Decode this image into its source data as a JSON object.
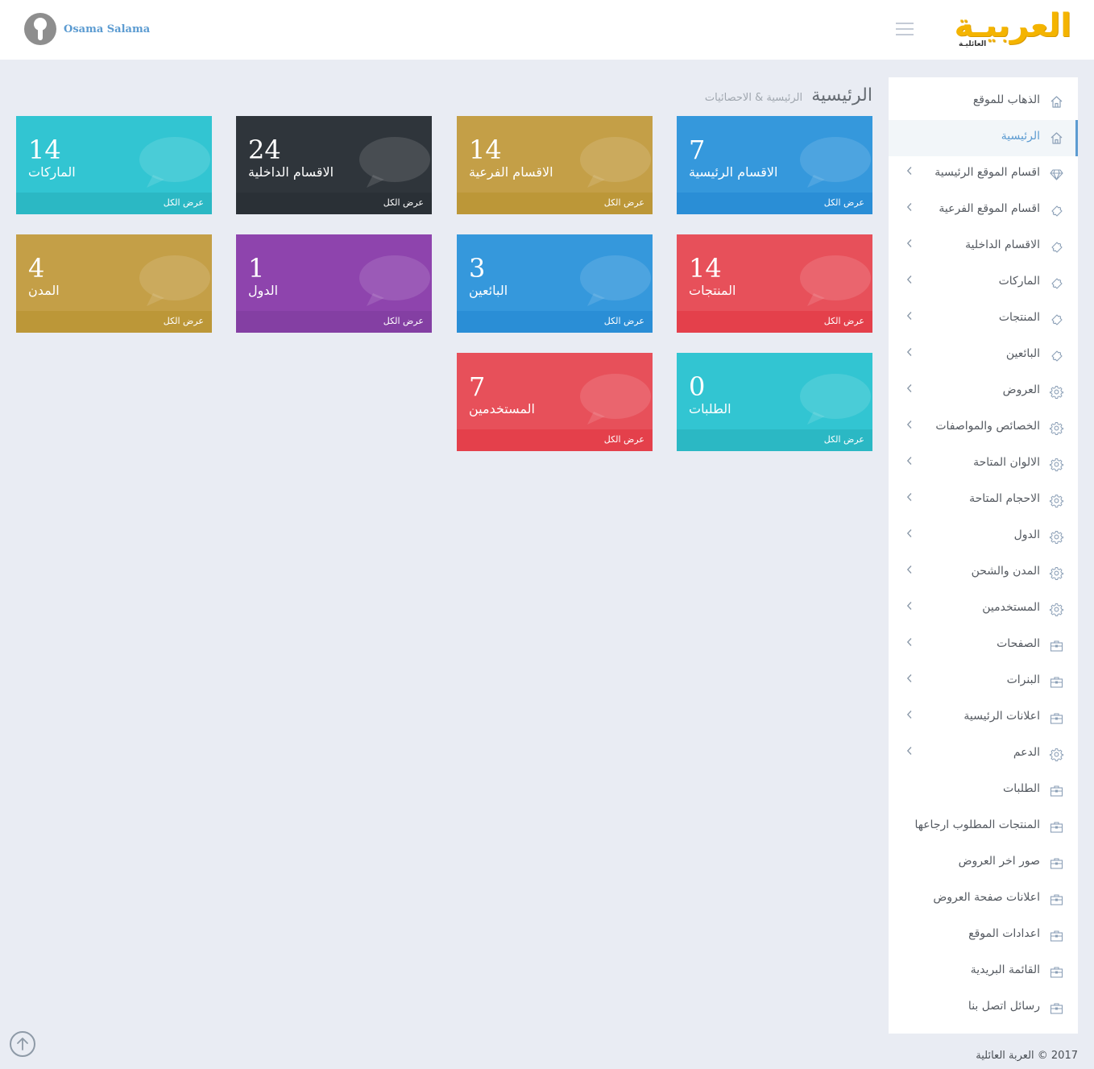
{
  "header": {
    "user_name": "Osama Salama",
    "logo_text": "العربيـة",
    "logo_subtext": "العائليـة",
    "colors": {
      "logo": "#f4b400",
      "user_name": "#5b9bd1"
    }
  },
  "page": {
    "title": "الرئيسية",
    "subtitle": "الرئيسية & الاحصائيات"
  },
  "sidebar": {
    "items": [
      {
        "label": "الذهاب للموقع",
        "icon": "home-icon",
        "arrow": false,
        "active": false
      },
      {
        "label": "الرئيسية",
        "icon": "home-icon",
        "arrow": false,
        "active": true
      },
      {
        "label": "اقسام الموقع الرئيسية",
        "icon": "diamond-icon",
        "arrow": true,
        "active": false
      },
      {
        "label": "اقسام الموقع الفرعية",
        "icon": "puzzle-icon",
        "arrow": true,
        "active": false
      },
      {
        "label": "الاقسام الداخلية",
        "icon": "puzzle-icon",
        "arrow": true,
        "active": false
      },
      {
        "label": "الماركات",
        "icon": "puzzle-icon",
        "arrow": true,
        "active": false
      },
      {
        "label": "المنتجات",
        "icon": "puzzle-icon",
        "arrow": true,
        "active": false
      },
      {
        "label": "البائعين",
        "icon": "puzzle-icon",
        "arrow": true,
        "active": false
      },
      {
        "label": "العروض",
        "icon": "gear-icon",
        "arrow": true,
        "active": false
      },
      {
        "label": "الخصائص والمواصفات",
        "icon": "gear-icon",
        "arrow": true,
        "active": false
      },
      {
        "label": "الالوان المتاحة",
        "icon": "gear-icon",
        "arrow": true,
        "active": false
      },
      {
        "label": "الاحجام المتاحة",
        "icon": "gear-icon",
        "arrow": true,
        "active": false
      },
      {
        "label": "الدول",
        "icon": "gear-icon",
        "arrow": true,
        "active": false
      },
      {
        "label": "المدن والشحن",
        "icon": "gear-icon",
        "arrow": true,
        "active": false
      },
      {
        "label": "المستخدمين",
        "icon": "gear-icon",
        "arrow": true,
        "active": false
      },
      {
        "label": "الصفحات",
        "icon": "briefcase-icon",
        "arrow": true,
        "active": false
      },
      {
        "label": "البنرات",
        "icon": "briefcase-icon",
        "arrow": true,
        "active": false
      },
      {
        "label": "اعلانات الرئيسية",
        "icon": "briefcase-icon",
        "arrow": true,
        "active": false
      },
      {
        "label": "الدعم",
        "icon": "gear-icon",
        "arrow": true,
        "active": false
      },
      {
        "label": "الطلبات",
        "icon": "briefcase-icon",
        "arrow": false,
        "active": false
      },
      {
        "label": "المنتجات المطلوب ارجاعها",
        "icon": "briefcase-icon",
        "arrow": false,
        "active": false
      },
      {
        "label": "صور اخر العروض",
        "icon": "briefcase-icon",
        "arrow": false,
        "active": false
      },
      {
        "label": "اعلانات صفحة العروض",
        "icon": "briefcase-icon",
        "arrow": false,
        "active": false
      },
      {
        "label": "اعدادات الموقع",
        "icon": "briefcase-icon",
        "arrow": false,
        "active": false
      },
      {
        "label": "القائمة البريدية",
        "icon": "briefcase-icon",
        "arrow": false,
        "active": false
      },
      {
        "label": "رسائل اتصل بنا",
        "icon": "briefcase-icon",
        "arrow": false,
        "active": false
      }
    ]
  },
  "tiles": [
    {
      "number": "7",
      "title": "الاقسام الرئيسية",
      "more": "عرض الكل",
      "color": "blue"
    },
    {
      "number": "14",
      "title": "الاقسام الفرعية",
      "more": "عرض الكل",
      "color": "gold"
    },
    {
      "number": "24",
      "title": "الاقسام الداخلية",
      "more": "عرض الكل",
      "color": "dark"
    },
    {
      "number": "14",
      "title": "الماركات",
      "more": "عرض الكل",
      "color": "cyan"
    },
    {
      "number": "14",
      "title": "المنتجات",
      "more": "عرض الكل",
      "color": "red"
    },
    {
      "number": "3",
      "title": "البائعين",
      "more": "عرض الكل",
      "color": "blue"
    },
    {
      "number": "1",
      "title": "الدول",
      "more": "عرض الكل",
      "color": "purple"
    },
    {
      "number": "4",
      "title": "المدن",
      "more": "عرض الكل",
      "color": "gold"
    },
    {
      "number": "0",
      "title": "الطلبات",
      "more": "عرض الكل",
      "color": "cyan"
    },
    {
      "number": "7",
      "title": "المستخدمين",
      "more": "عرض الكل",
      "color": "red"
    }
  ],
  "footer": {
    "text": "2017 © العربة العائلية"
  }
}
